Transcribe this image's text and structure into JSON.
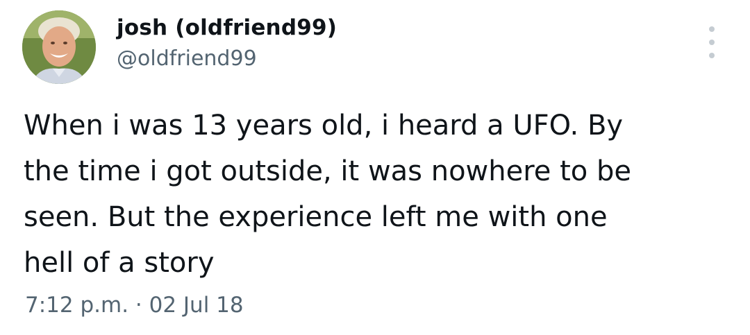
{
  "author": {
    "display_name": "josh (oldfriend99)",
    "handle": "@oldfriend99",
    "avatar_icon": "profile-photo"
  },
  "tweet": {
    "text": "When i was 13 years old, i heard a UFO. By\nthe time i got outside, it was nowhere to be\nseen. But the experience left me with one\nhell of a story",
    "timestamp": "7:12 p.m. · 02 Jul 18"
  },
  "actions": {
    "more_icon": "more-vertical-icon"
  },
  "colors": {
    "text_primary": "#0f1419",
    "text_secondary": "#536471",
    "icon_muted": "#c5ccd2",
    "background": "#ffffff"
  }
}
